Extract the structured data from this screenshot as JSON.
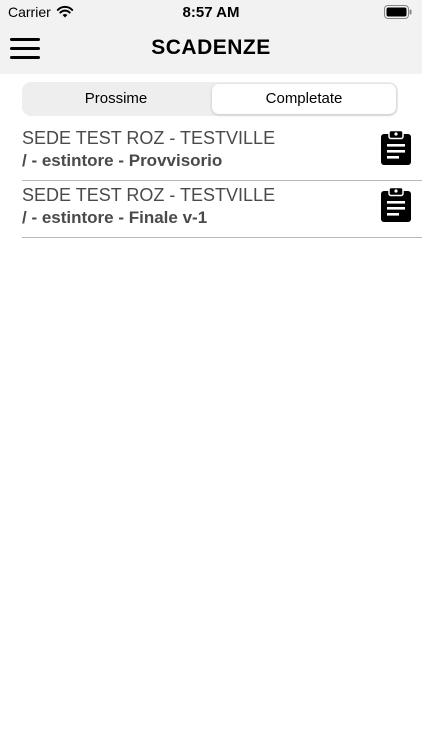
{
  "status_bar": {
    "carrier": "Carrier",
    "time": "8:57 AM"
  },
  "nav": {
    "title": "SCADENZE",
    "menu_icon": "hamburger-menu-icon"
  },
  "segmented": {
    "options": [
      "Prossime",
      "Completate"
    ],
    "selected": "Completate"
  },
  "list": {
    "items": [
      {
        "line1": "SEDE TEST ROZ - TESTVILLE",
        "line2": "/ - estintore - Provvisorio",
        "icon": "clipboard-icon"
      },
      {
        "line1": "SEDE TEST ROZ - TESTVILLE",
        "line2": "/ - estintore - Finale v-1",
        "icon": "clipboard-icon"
      }
    ]
  }
}
